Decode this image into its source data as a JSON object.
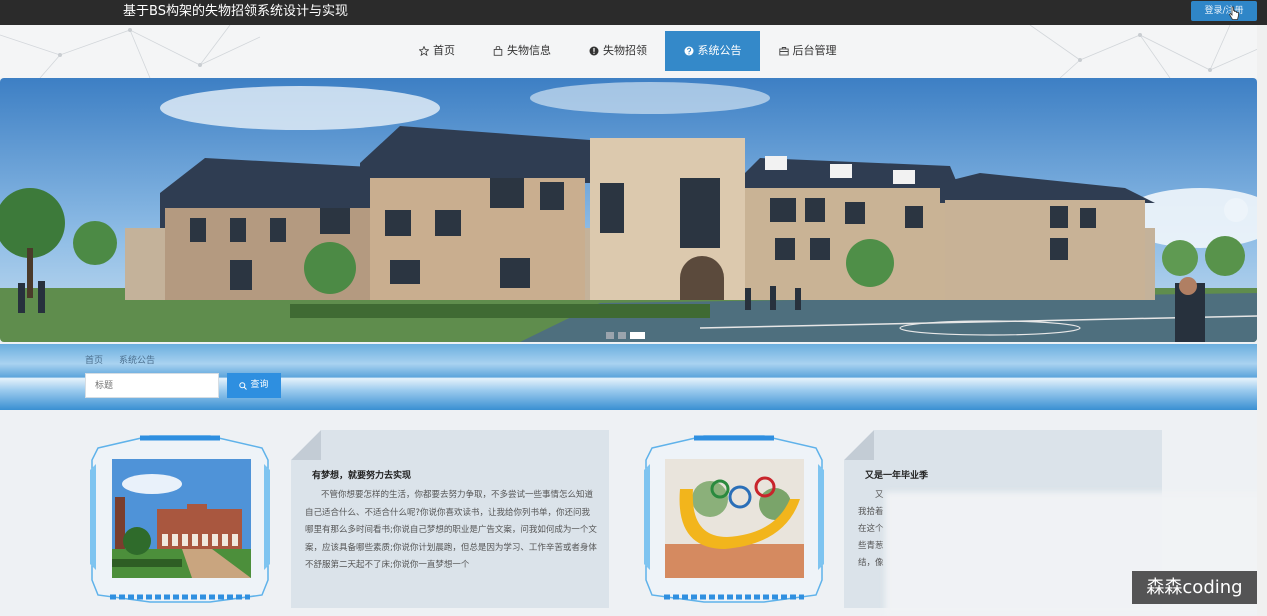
{
  "header": {
    "site_title": "基于BS构架的失物招领系统设计与实现",
    "login_label": "登录/注册"
  },
  "nav": {
    "items": [
      {
        "label": "首页",
        "icon": "star-icon"
      },
      {
        "label": "失物信息",
        "icon": "bag-icon"
      },
      {
        "label": "失物招领",
        "icon": "info-circle-icon"
      },
      {
        "label": "系统公告",
        "icon": "circle-question-icon",
        "active": true
      },
      {
        "label": "后台管理",
        "icon": "briefcase-icon"
      }
    ],
    "active_color": "#3489c9"
  },
  "banner": {
    "slide_count": 3,
    "active_slide": 3
  },
  "breadcrumb": {
    "items": [
      "首页",
      "系统公告"
    ]
  },
  "search": {
    "placeholder": "标题",
    "button_label": "查询"
  },
  "cards": [
    {
      "title": "有梦想，就要努力去实现",
      "body": "不管你想要怎样的生活，你都要去努力争取，不多尝试一些事情怎么知道自己适合什么、不适合什么呢?你说你喜欢读书，让我给你列书单，你还问我哪里有那么多时间看书;你说自己梦想的职业是广告文案，问我如何成为一个文案，应该具备哪些素质;你说你计划晨跑，但总是因为学习、工作辛苦或者身体不舒服第二天起不了床;你说你一直梦想一个"
    },
    {
      "title": "又是一年毕业季",
      "body_lines": [
        "又",
        "我拾着",
        "在这个",
        "些青葱",
        "结，像"
      ]
    }
  ],
  "watermark": "森森coding"
}
